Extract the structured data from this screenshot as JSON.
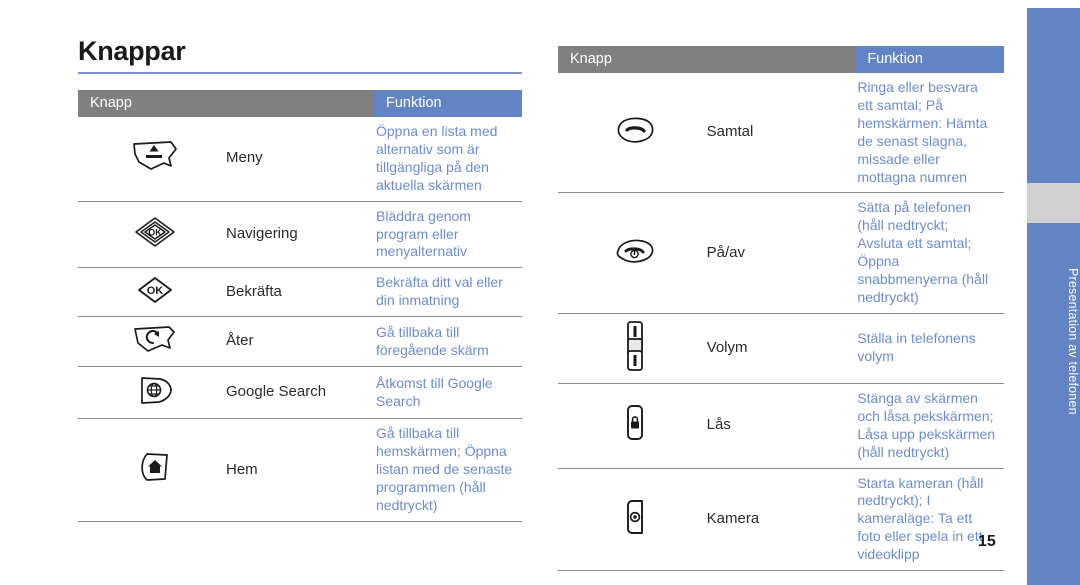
{
  "page": {
    "title": "Knappar",
    "number": "15",
    "side_tab_label": "Presentation av telefonen",
    "accent_blue": "#6384c4",
    "header_gray": "#808080",
    "desc_text_color": "#6d8ccb",
    "rule_color": "#7a93cf"
  },
  "tables": [
    {
      "id": "left",
      "headers": {
        "key": "Knapp",
        "function": "Funktion"
      },
      "rows": [
        {
          "icon": "menu-key-icon",
          "name": "Meny",
          "description": "Öppna en lista med alternativ som är tillgängliga på den aktuella skärmen"
        },
        {
          "icon": "navigation-key-icon",
          "name": "Navigering",
          "description": "Bläddra genom program eller menyalternativ"
        },
        {
          "icon": "confirm-ok-key-icon",
          "name": "Bekräfta",
          "description": "Bekräfta ditt val eller din inmatning"
        },
        {
          "icon": "back-key-icon",
          "name": "Åter",
          "description": "Gå tillbaka till föregående skärm"
        },
        {
          "icon": "google-search-key-icon",
          "name": "Google Search",
          "description": "Åtkomst till Google Search"
        },
        {
          "icon": "home-key-icon",
          "name": "Hem",
          "description": "Gå tillbaka till hemskärmen; Öppna listan med de senaste programmen (håll nedtryckt)"
        }
      ]
    },
    {
      "id": "right",
      "headers": {
        "key": "Knapp",
        "function": "Funktion"
      },
      "rows": [
        {
          "icon": "call-key-icon",
          "name": "Samtal",
          "description": "Ringa eller besvara ett samtal; På hemskärmen: Hämta de senast slagna, missade eller mottagna numren"
        },
        {
          "icon": "power-end-key-icon",
          "name": "På/av",
          "description": "Sätta på telefonen (håll nedtryckt; Avsluta ett samtal; Öppna snabbmenyerna (håll nedtryckt)"
        },
        {
          "icon": "volume-key-icon",
          "name": "Volym",
          "description": "Ställa in telefonens volym"
        },
        {
          "icon": "lock-key-icon",
          "name": "Lås",
          "description": "Stänga av skärmen och låsa pekskärmen; Låsa upp pekskärmen (håll nedtryckt)"
        },
        {
          "icon": "camera-key-icon",
          "name": "Kamera",
          "description": "Starta kameran (håll nedtryckt); I kameraläge: Ta ett foto eller spela in ett videoklipp"
        }
      ]
    }
  ]
}
